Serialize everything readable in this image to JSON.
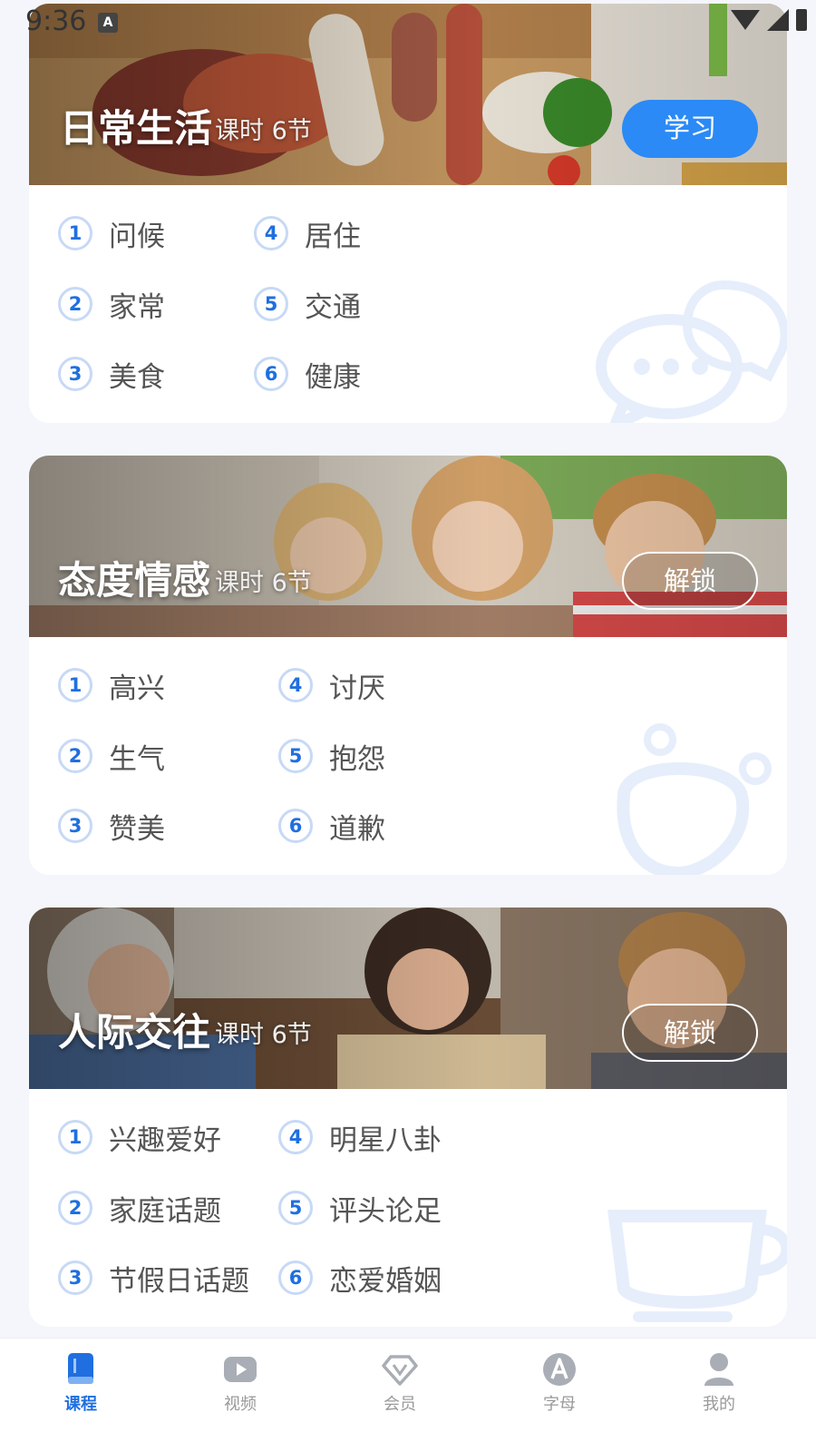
{
  "status_bar": {
    "time": "9:36",
    "badge": "A"
  },
  "cards": [
    {
      "title": "日常生活",
      "meta": "课时 6节",
      "button": "学习",
      "lessons": [
        {
          "num": "1",
          "label": "问候"
        },
        {
          "num": "2",
          "label": "家常"
        },
        {
          "num": "3",
          "label": "美食"
        },
        {
          "num": "4",
          "label": "居住"
        },
        {
          "num": "5",
          "label": "交通"
        },
        {
          "num": "6",
          "label": "健康"
        }
      ]
    },
    {
      "title": "态度情感",
      "meta": "课时 6节",
      "button": "解锁",
      "lessons": [
        {
          "num": "1",
          "label": "高兴"
        },
        {
          "num": "2",
          "label": "生气"
        },
        {
          "num": "3",
          "label": "赞美"
        },
        {
          "num": "4",
          "label": "讨厌"
        },
        {
          "num": "5",
          "label": "抱怨"
        },
        {
          "num": "6",
          "label": "道歉"
        }
      ]
    },
    {
      "title": "人际交往",
      "meta": "课时 6节",
      "button": "解锁",
      "lessons": [
        {
          "num": "1",
          "label": "兴趣爱好"
        },
        {
          "num": "2",
          "label": "家庭话题"
        },
        {
          "num": "3",
          "label": "节假日话题"
        },
        {
          "num": "4",
          "label": "明星八卦"
        },
        {
          "num": "5",
          "label": "评头论足"
        },
        {
          "num": "6",
          "label": "恋爱婚姻"
        }
      ]
    }
  ],
  "tabbar": {
    "active": "courses",
    "items": [
      {
        "key": "courses",
        "label": "课程",
        "icon": "book-icon"
      },
      {
        "key": "video",
        "label": "视频",
        "icon": "play-icon"
      },
      {
        "key": "vip",
        "label": "会员",
        "icon": "diamond-icon"
      },
      {
        "key": "alphabet",
        "label": "字母",
        "icon": "letter-a-icon"
      },
      {
        "key": "me",
        "label": "我的",
        "icon": "user-icon"
      }
    ]
  },
  "colors": {
    "accent": "#2b8af5",
    "num_text": "#1f6fe0",
    "num_ring": "#c7d9f6",
    "background": "#f4f6fb"
  }
}
